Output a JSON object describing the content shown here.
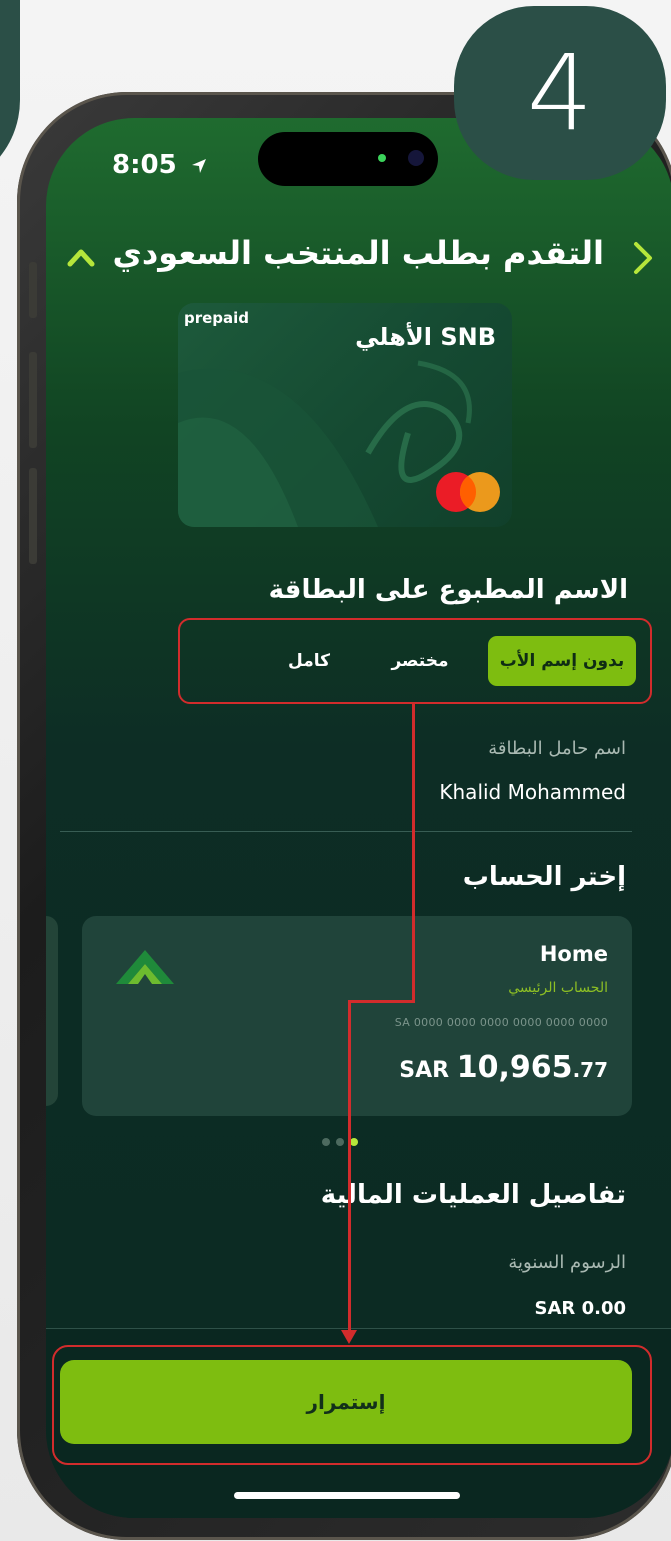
{
  "step": {
    "number": "4"
  },
  "status_bar": {
    "time": "8:05"
  },
  "header": {
    "title": "التقدم بطلب المنتخب السعودي"
  },
  "card": {
    "prepaid_label": "prepaid",
    "brand_text": "الأهلي SNB"
  },
  "name_on_card": {
    "title": "الاسم المطبوع على البطاقة",
    "options": [
      {
        "label": "بدون إسم الأب",
        "selected": true
      },
      {
        "label": "مختصر",
        "selected": false
      },
      {
        "label": "كامل",
        "selected": false
      }
    ],
    "holder_label": "اسم حامل البطاقة",
    "holder_value": "Khalid Mohammed"
  },
  "account_select": {
    "title": "إختر الحساب",
    "account": {
      "name": "Home",
      "type": "الحساب الرئيسي",
      "iban": "SA 0000 0000 0000 0000 0000 0000",
      "currency": "SAR",
      "balance_main": "10,965",
      "balance_cents": ".77"
    },
    "pager": {
      "count": 3,
      "active_index": 2
    }
  },
  "financial_details": {
    "title": "تفاصيل العمليات المالية",
    "annual_fee_label": "الرسوم السنوية",
    "annual_fee_currency": "SAR",
    "annual_fee_value": "0.00"
  },
  "actions": {
    "continue_label": "إستمرار"
  },
  "colors": {
    "accent_green": "#7ebd10",
    "annotation_red": "#d22c2c",
    "step_bubble": "#2b4f47",
    "screen_dark": "#0b2a22"
  }
}
